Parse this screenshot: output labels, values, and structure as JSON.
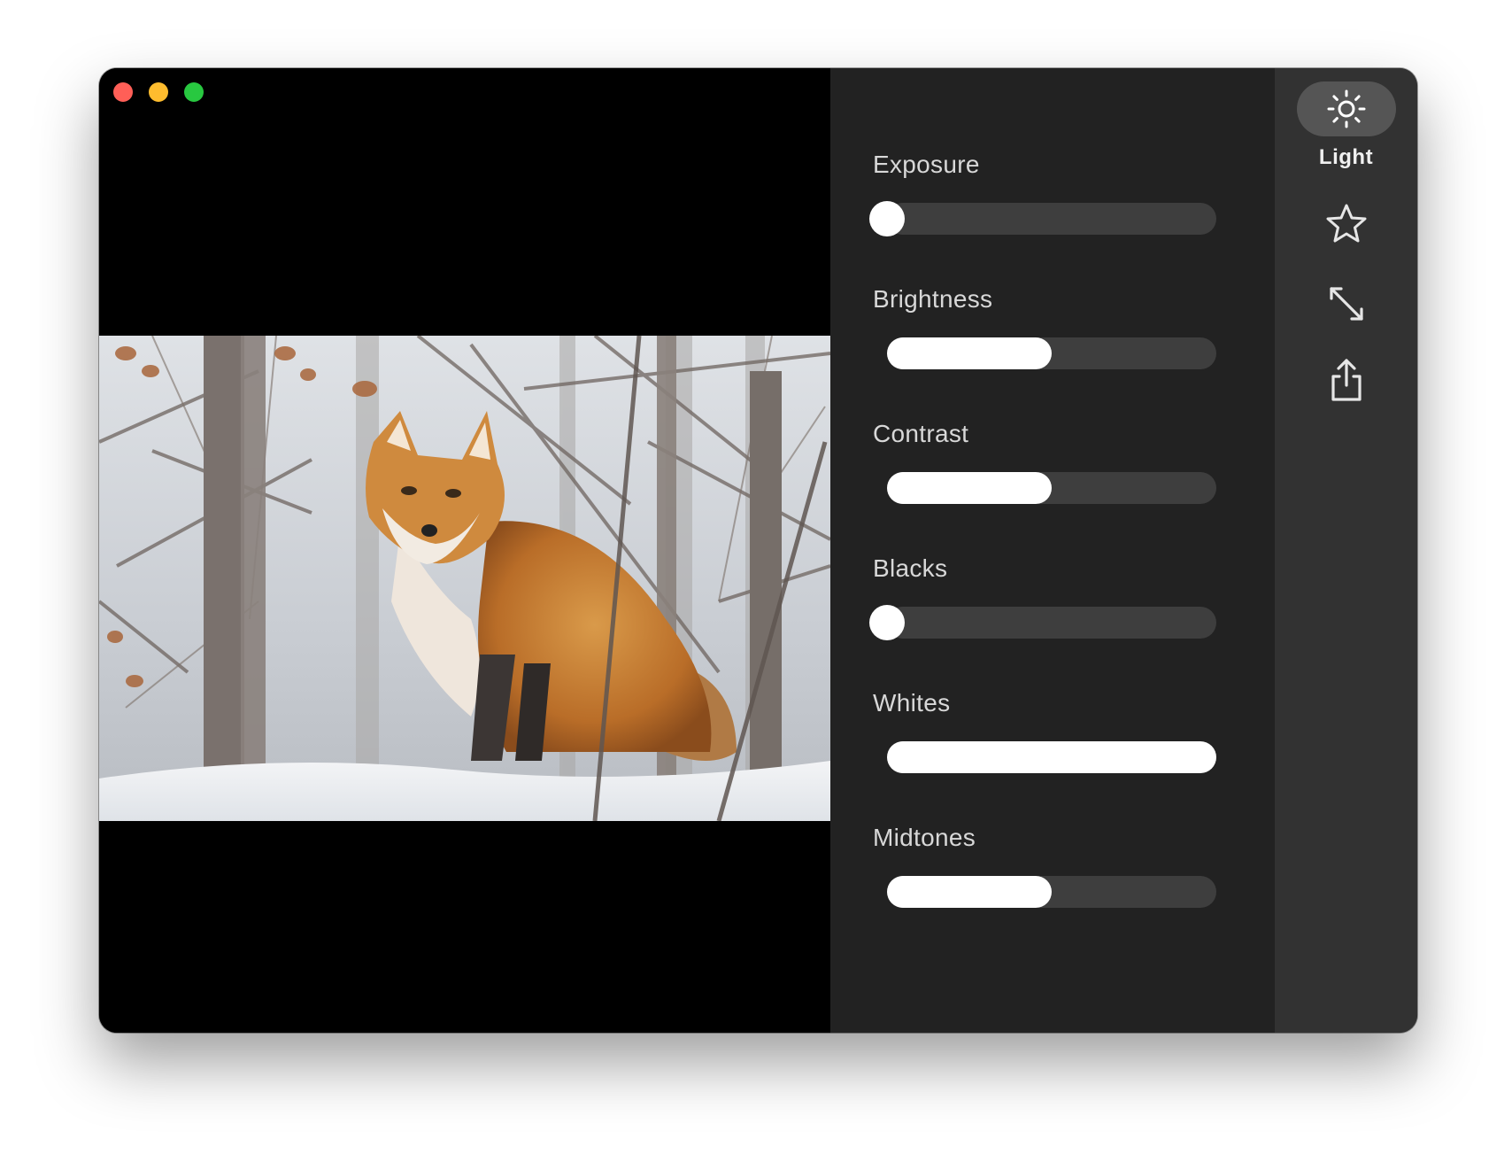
{
  "window": {
    "traffic_lights": [
      "close",
      "minimize",
      "maximize"
    ]
  },
  "viewer": {
    "photo_subject": "red fox in snowy forest"
  },
  "adjustments": [
    {
      "label": "Exposure",
      "value": 0.0,
      "style": "knob"
    },
    {
      "label": "Brightness",
      "value": 0.5,
      "style": "fill"
    },
    {
      "label": "Contrast",
      "value": 0.5,
      "style": "fill"
    },
    {
      "label": "Blacks",
      "value": 0.0,
      "style": "knob"
    },
    {
      "label": "Whites",
      "value": 1.0,
      "style": "fill"
    },
    {
      "label": "Midtones",
      "value": 0.5,
      "style": "fill"
    }
  ],
  "toolbar": {
    "light_label": "Light",
    "tools": [
      "sun-icon",
      "star-icon",
      "resize-icon",
      "share-icon"
    ],
    "selected": "light"
  },
  "colors": {
    "panel_bg": "#222222",
    "toolbar_bg": "#323232",
    "track_bg": "#3e3e3e",
    "fill": "#ffffff",
    "selected_pill": "#555555"
  }
}
